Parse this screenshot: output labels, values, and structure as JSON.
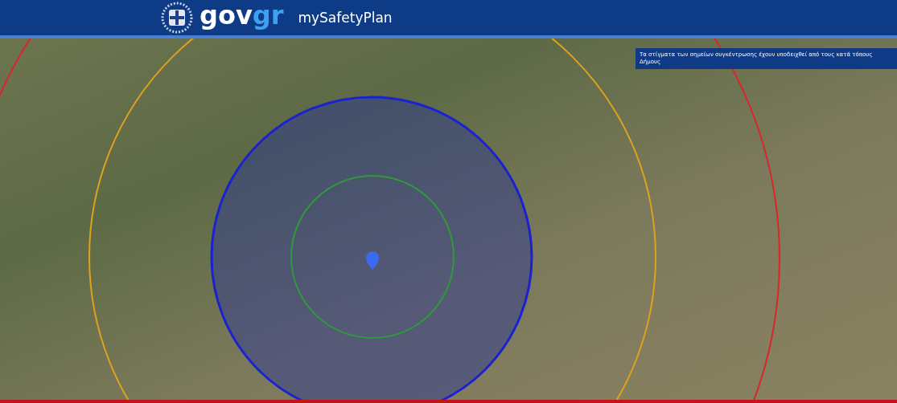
{
  "header": {
    "logo_part_1": "gov",
    "logo_part_2": "gr",
    "app_name": "mySafetyPlan"
  },
  "map": {
    "note": "Τα στίγματα των σημείων συγκέντρωσης έχουν υποδειχθεί από τους κατά τόπους Δήμους"
  }
}
